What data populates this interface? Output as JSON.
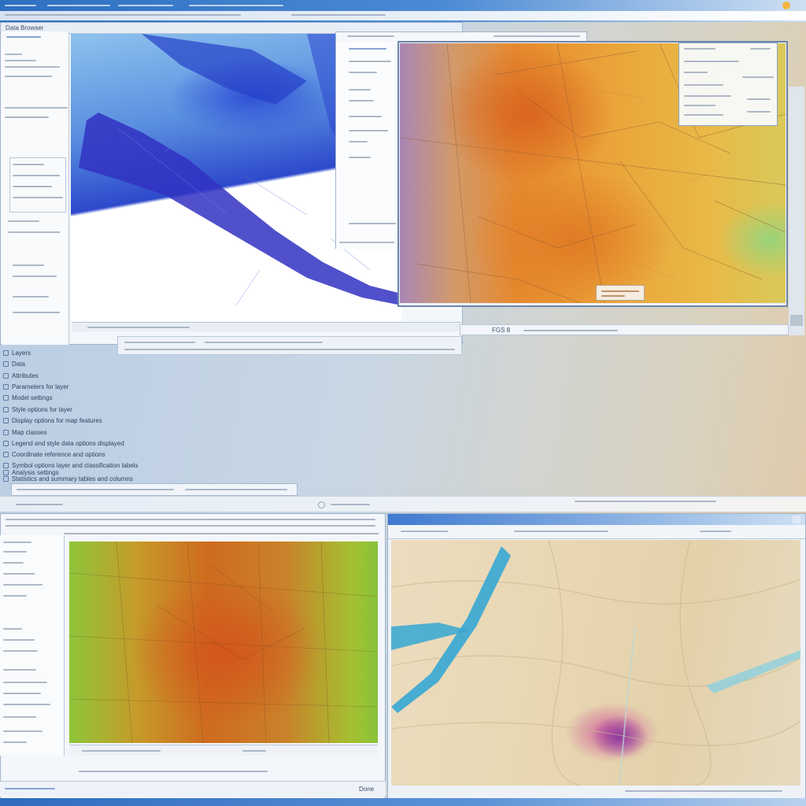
{
  "screen": {
    "description_labels": [
      "Data Browser",
      "Layers"
    ],
    "accent": "#2e6fc2",
    "map_colors": {
      "blue_map": "#2d49cc",
      "orange_map": "#e6892e",
      "green_orange_map": "#cf6b1f",
      "sand_map": "#e8d7b2",
      "water": "#36a7d4",
      "hotspot": "#8e3aa0"
    }
  },
  "left_window": {
    "panel_label": "Data Browser"
  },
  "layer_list": {
    "items": [
      "Layers",
      "Data",
      "Attributes",
      "Parameters for layer",
      "Model settings",
      "Style options for layer",
      "Display options for map features",
      "Map classes",
      "Legend and style data options displayed",
      "Coordinate reference and options",
      "Symbol options layer and classification labels",
      "Analysis settings",
      "Statistics and summary tables and columns"
    ]
  },
  "right_window": {
    "status_label": "FGS 8"
  },
  "bottom_left_window": {
    "footer_label": "Done"
  },
  "icons": {
    "window_icon": "window-icon",
    "layer_icon": "layer-checkbox-icon",
    "close": "close-icon"
  }
}
